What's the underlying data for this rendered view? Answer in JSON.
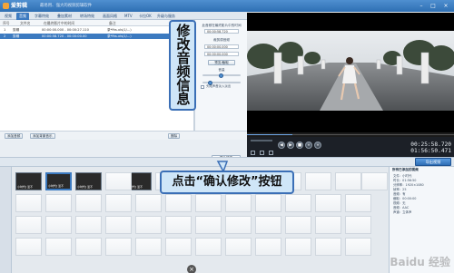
{
  "window": {
    "app_name": "爱剪辑",
    "subtitle": "最易用、强大的视频剪辑软件"
  },
  "tabs": [
    "视频",
    "音频",
    "字幕特效",
    "叠加素材",
    "转场特效",
    "画面风格",
    "MTV",
    "卡拉OK",
    "升级与服务"
  ],
  "list": {
    "headers": [
      "序号",
      "文件名",
      "在最终影片中的时间",
      "备注"
    ],
    "rows": [
      {
        "index": "1",
        "file": "剪辑",
        "time": "00:00:00.000 - 00:00:27.110",
        "note": "录*fhs.xls(1/...)"
      },
      {
        "index": "2",
        "file": "剪辑",
        "time": "00:00:58.720 - 00:00:00.00",
        "note": "录*fhs.xls(1/...)"
      }
    ]
  },
  "props": {
    "heading": "此音频在最终影片中的时间",
    "time_field": "00:00:58.720",
    "sub_heading": "裁剪原音频",
    "start_field": "00:00:00.000",
    "end_field": "00:00:00.000",
    "preview_btn": "预览/截取",
    "volume_label": "音量",
    "fade_label": "头尾声音淡入淡出",
    "confirm_btn": "确认修改"
  },
  "bottom_buttons": {
    "add_audio": "添加音频",
    "add_bgm": "添加背景音乐",
    "delete": "删除"
  },
  "player": {
    "current": "00:25:58.720",
    "total": "01:56:50.471"
  },
  "timeline": {
    "export_label": "导出视频",
    "clips": [
      "小时代] 爱不",
      "小时代] 爱不",
      "小时代] 爱不",
      "小时代] 爱不"
    ]
  },
  "right_panel": {
    "title": "所有已添加的视频",
    "lines": [
      "文件：小时代",
      "时长：01:56:50",
      "分辨率：1920×1080",
      "帧率：25",
      "音频：有",
      "截取：00:00:00",
      "视频：无",
      "音频：AAC",
      "声道：立体声"
    ]
  },
  "callouts": {
    "top": "修改音频信息",
    "bottom": "点击“确认修改”按钮"
  },
  "watermark": "Baidu 经验",
  "colors": {
    "accent": "#3c7ac0",
    "callout_fill": "#cfe6f8",
    "callout_border": "#3b6fb6"
  }
}
